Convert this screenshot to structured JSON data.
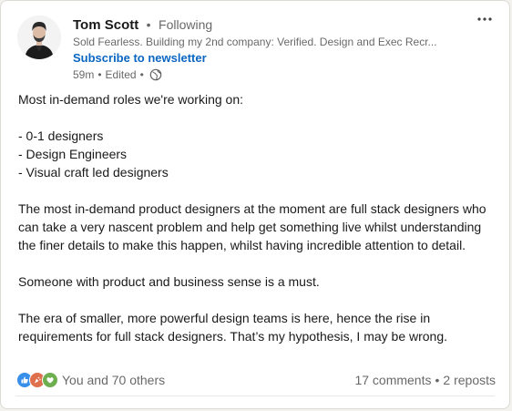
{
  "post": {
    "author": {
      "name": "Tom Scott",
      "separator": "•",
      "follow_status": "Following",
      "headline": "Sold Fearless. Building my 2nd company: Verified. Design and Exec Recr...",
      "subscribe_label": "Subscribe to newsletter",
      "time_ago": "59m",
      "edited_label": "Edited",
      "visibility_icon": "globe-icon"
    },
    "more_icon": "ellipsis-icon",
    "body": {
      "intro": "Most in-demand roles we're working on:",
      "roles": [
        "- 0-1 designers",
        "- Design Engineers",
        "- Visual craft led designers"
      ],
      "paragraph_1": "The most in-demand product designers at the moment are full stack designers who can take a very nascent problem and help get something live whilst understanding the finer details to make this happen, whilst having incredible attention to detail.",
      "paragraph_2": "Someone with product and business sense is a must.",
      "paragraph_3": "The era of smaller, more powerful design teams is here, hence the rise in requirements for full stack designers. That’s my hypothesis, I may be wrong."
    },
    "social": {
      "reaction_icons": [
        "like-icon",
        "celebrate-icon",
        "support-icon"
      ],
      "reactions_text": "You and 70 others",
      "comments": "17 comments",
      "separator": "•",
      "reposts": "2 reposts"
    },
    "colors": {
      "link_blue": "#0a66c2",
      "like": "#378fe9",
      "celebrate": "#df704d",
      "support": "#6dae4f"
    }
  }
}
